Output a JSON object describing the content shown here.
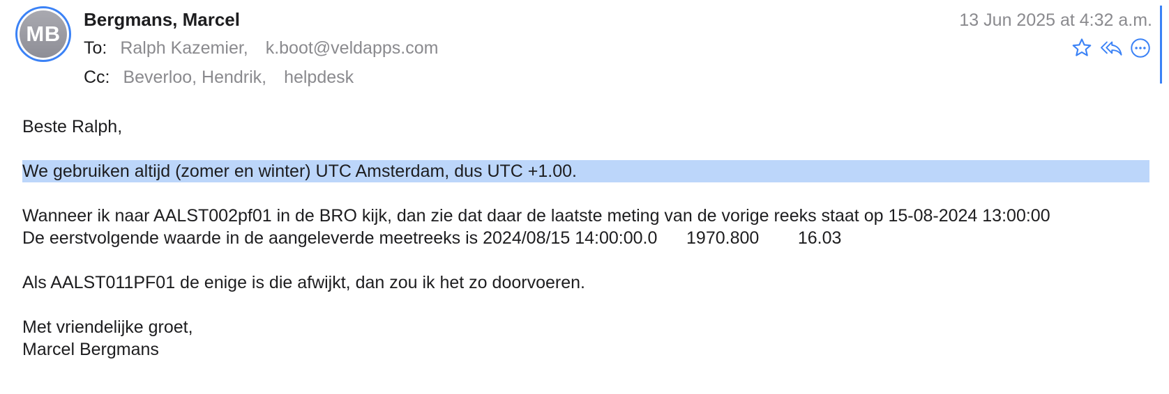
{
  "sender": {
    "initials": "MB",
    "name": "Bergmans, Marcel"
  },
  "date": "13 Jun 2025 at 4:32 a.m.",
  "to": {
    "label": "To:",
    "recipients": [
      "Ralph Kazemier,",
      "k.boot@veldapps.com"
    ]
  },
  "cc": {
    "label": "Cc:",
    "recipients": [
      "Beverloo, Hendrik,",
      "helpdesk"
    ]
  },
  "actions": {
    "flag_icon": "star-icon",
    "reply_all_icon": "reply-all-icon",
    "more_icon": "more-icon"
  },
  "body": {
    "greeting": "Beste Ralph,",
    "highlighted": "We gebruiken altijd (zomer en winter) UTC Amsterdam, dus UTC +1.00.",
    "para2_line1": "Wanneer ik naar AALST002pf01 in de BRO kijk, dan zie dat daar de laatste meting van de vorige reeks staat op 15-08-2024 13:00:00",
    "para2_line2": "De eerstvolgende waarde in de aangeleverde meetreeks is 2024/08/15 14:00:00.0      1970.800        16.03",
    "para3": "Als AALST011PF01 de enige is die afwijkt, dan zou ik het zo doorvoeren.",
    "closing": "Met vriendelijke groet,",
    "signature": "Marcel Bergmans"
  },
  "colors": {
    "accent": "#3b82f6",
    "selection": "#bcd6fa",
    "secondary_text": "#8a8a8e"
  }
}
